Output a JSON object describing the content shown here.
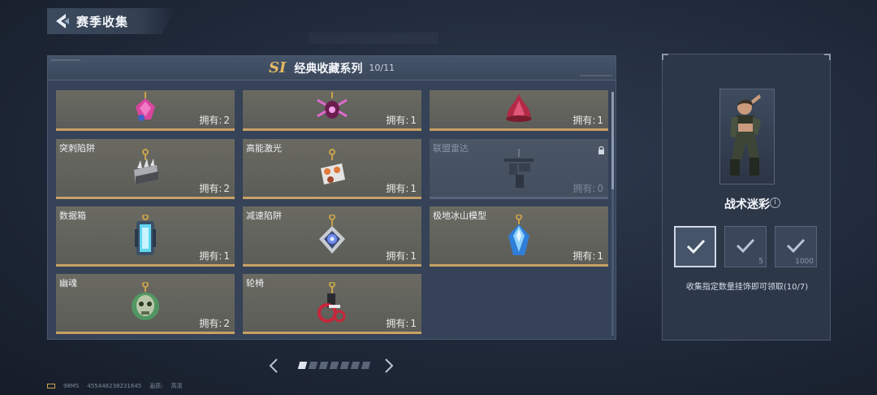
{
  "header": {
    "title": "赛季收集"
  },
  "panel": {
    "season_badge": "SI",
    "series_name": "经典收藏系列",
    "series_count": "10/11",
    "owned_label": "拥有:"
  },
  "cards": [
    {
      "name": "",
      "owned": "2",
      "locked": false,
      "icon": "pink-crystal-charm-icon"
    },
    {
      "name": "",
      "owned": "1",
      "locked": false,
      "icon": "spider-charm-icon"
    },
    {
      "name": "",
      "owned": "1",
      "locked": false,
      "icon": "red-flower-charm-icon"
    },
    {
      "name": "突刺陷阱",
      "owned": "2",
      "locked": false,
      "icon": "spike-trap-charm-icon"
    },
    {
      "name": "高能激光",
      "owned": "1",
      "locked": false,
      "icon": "laser-charm-icon"
    },
    {
      "name": "联盟雷达",
      "owned": "0",
      "locked": true,
      "icon": "radar-charm-icon"
    },
    {
      "name": "数据箱",
      "owned": "1",
      "locked": false,
      "icon": "data-box-charm-icon"
    },
    {
      "name": "减速陷阱",
      "owned": "1",
      "locked": false,
      "icon": "slow-trap-charm-icon"
    },
    {
      "name": "极地冰山模型",
      "owned": "1",
      "locked": false,
      "icon": "iceberg-charm-icon"
    },
    {
      "name": "幽魂",
      "owned": "2",
      "locked": false,
      "icon": "ghost-skull-charm-icon"
    },
    {
      "name": "轮椅",
      "owned": "1",
      "locked": false,
      "icon": "wheelchair-charm-icon"
    }
  ],
  "pager": {
    "page_count": 7,
    "current_page": 1
  },
  "reward": {
    "name": "战术迷彩",
    "info_icon": "i",
    "tiers": [
      {
        "value": "",
        "selected": true
      },
      {
        "value": "5",
        "selected": false
      },
      {
        "value": "1000",
        "selected": false
      }
    ],
    "description": "收集指定数量挂饰即可领取(10/7)"
  },
  "footer": {
    "ping": "98MS",
    "uid": "455448238231645",
    "quality_label": "画质:",
    "quality_value": "高清"
  },
  "colors": {
    "accent_gold": "#c7a165",
    "season_gold": "#e4b862",
    "panel_bg": "#354257"
  }
}
